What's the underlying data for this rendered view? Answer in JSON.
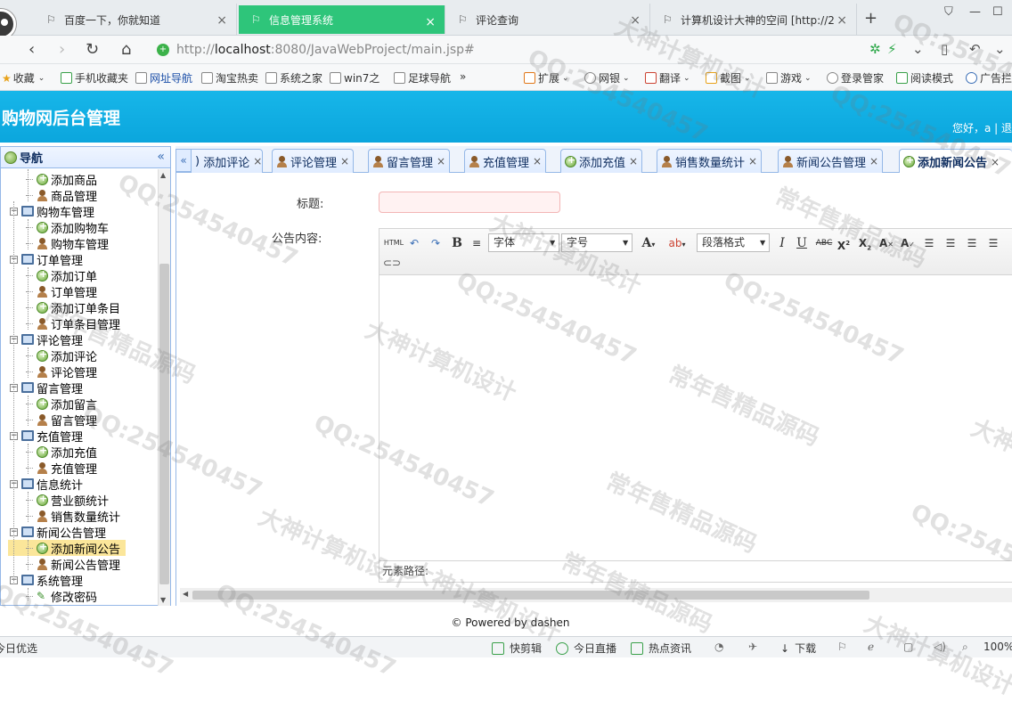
{
  "browser": {
    "tabs": [
      {
        "title": "百度一下，你就知道"
      },
      {
        "title": "信息管理系统"
      },
      {
        "title": "评论查询"
      },
      {
        "title": "计算机设计大神的空间 [http://2"
      }
    ],
    "url_prefix": "http://",
    "url_host": "localhost",
    "url_rest": ":8080/JavaWebProject/main.jsp#"
  },
  "bookmarks": [
    "收藏",
    "手机收藏夹",
    "网址导航",
    "淘宝热卖",
    "系统之家",
    "win7之",
    "足球导航",
    "»",
    "扩展",
    "网银",
    "翻译",
    "截图",
    "游戏",
    "登录管家",
    "阅读模式",
    "广告拦"
  ],
  "app": {
    "title": "购物网后台管理",
    "greeting": "您好，a | 退"
  },
  "nav": {
    "header": "导航",
    "items": [
      "添加商品",
      "商品管理",
      "购物车管理",
      "添加购物车",
      "购物车管理",
      "订单管理",
      "添加订单",
      "订单管理",
      "添加订单条目",
      "订单条目管理",
      "评论管理",
      "添加评论",
      "评论管理",
      "留言管理",
      "添加留言",
      "留言管理",
      "充值管理",
      "添加充值",
      "充值管理",
      "信息统计",
      "营业额统计",
      "销售数量统计",
      "新闻公告管理",
      "添加新闻公告",
      "新闻公告管理",
      "系统管理",
      "修改密码"
    ]
  },
  "content_tabs": [
    "添加评论",
    "评论管理",
    "留言管理",
    "充值管理",
    "添加充值",
    "销售数量统计",
    "新闻公告管理",
    "添加新闻公告"
  ],
  "form": {
    "title_label": "标题:",
    "content_label": "公告内容:",
    "title_value": ""
  },
  "editor": {
    "html_btn": "HTML",
    "font_family": "字体",
    "font_size": "字号",
    "paragraph": "段落格式",
    "element_path": "元素路径:"
  },
  "footer": "© Powered by dashen",
  "statusbar": [
    "今日优选",
    "快剪辑",
    "今日直播",
    "热点资讯",
    "下载",
    "100%"
  ],
  "watermarks": [
    "QQ:254540457",
    "常年售精品源码",
    "大神计算机设计"
  ]
}
